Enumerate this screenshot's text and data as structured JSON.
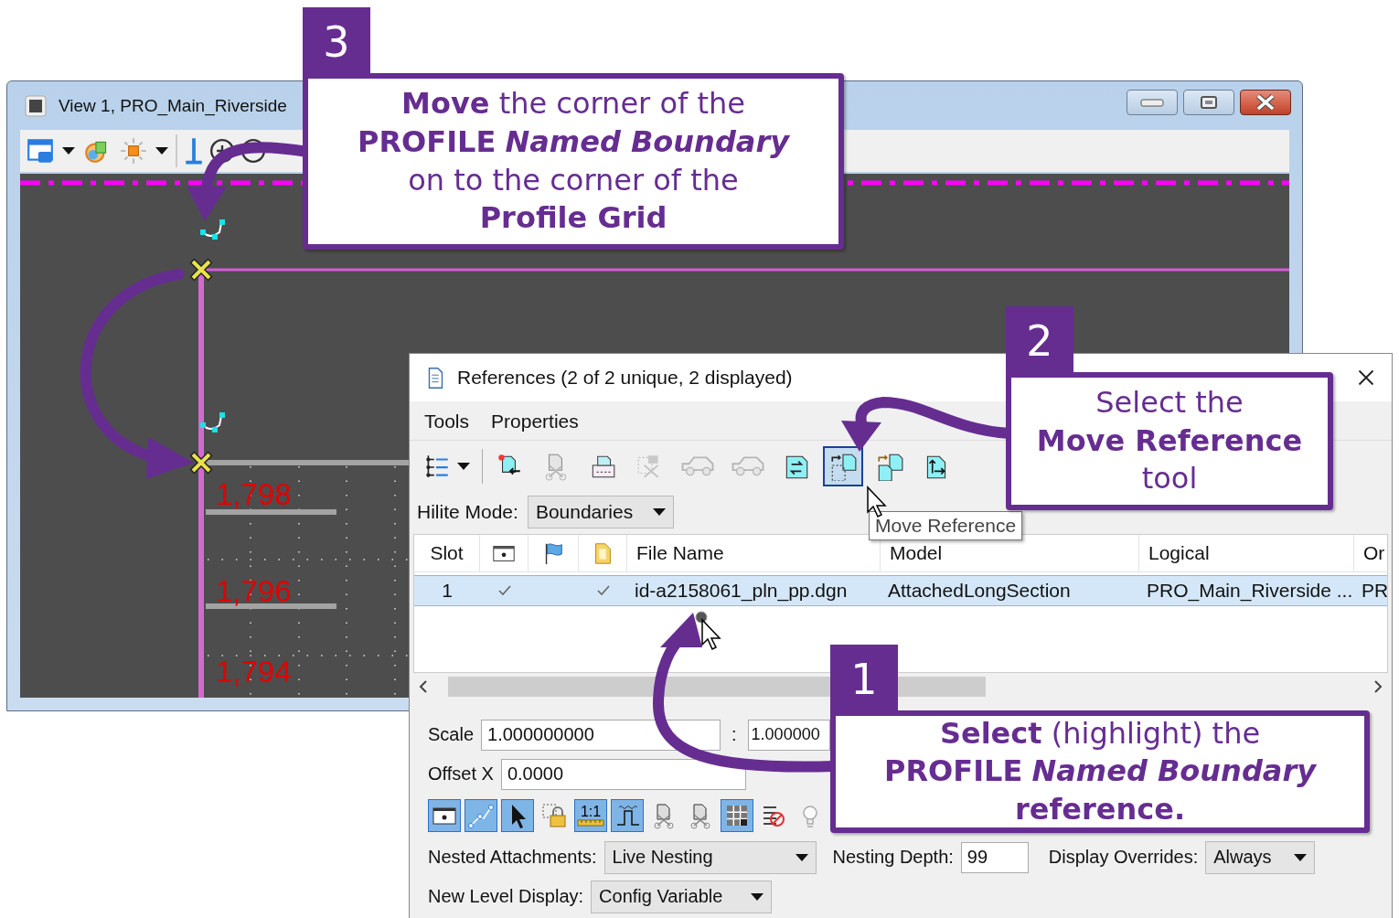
{
  "view_window": {
    "title": "View 1, PRO_Main_Riverside",
    "elevation_labels": [
      "1,798",
      "1,796",
      "1,794"
    ]
  },
  "references_dialog": {
    "title": "References (2 of 2 unique, 2 displayed)",
    "menu": [
      "Tools",
      "Properties"
    ],
    "toolbar": [
      {
        "kind": "tree",
        "selected": false,
        "disabled": false
      },
      {
        "kind": "attach",
        "selected": false,
        "disabled": false
      },
      {
        "kind": "detach",
        "selected": false,
        "disabled": true
      },
      {
        "kind": "print",
        "selected": false,
        "disabled": false
      },
      {
        "kind": "clip",
        "selected": false,
        "disabled": true
      },
      {
        "kind": "car",
        "selected": false,
        "disabled": true
      },
      {
        "kind": "car-back",
        "selected": false,
        "disabled": true
      },
      {
        "kind": "exchange",
        "selected": false,
        "disabled": false
      },
      {
        "kind": "move",
        "selected": true,
        "disabled": false
      },
      {
        "kind": "copy",
        "selected": false,
        "disabled": false
      },
      {
        "kind": "scale",
        "selected": false,
        "disabled": false
      }
    ],
    "tooltip": "Move Reference",
    "hilite_mode": {
      "label": "Hilite Mode:",
      "value": "Boundaries"
    },
    "table": {
      "columns": [
        {
          "kind": "text",
          "label": "Slot"
        },
        {
          "kind": "display-icon"
        },
        {
          "kind": "flag-icon"
        },
        {
          "kind": "document-icon"
        },
        {
          "kind": "text",
          "label": "File Name"
        },
        {
          "kind": "text",
          "label": "Model"
        },
        {
          "kind": "text",
          "label": "Logical"
        },
        {
          "kind": "text",
          "label": "Or"
        }
      ],
      "rows": [
        {
          "selected": true,
          "slot": "1",
          "checks": [
            true,
            false,
            true
          ],
          "file_name": "id-a2158061_pln_pp.dgn",
          "model": "AttachedLongSection",
          "logical": "PRO_Main_Riverside ...",
          "column_8": "PR"
        }
      ]
    },
    "scale": {
      "label": "Scale",
      "value": "1.000000000",
      "separator": ":",
      "value_2": "1.000000"
    },
    "offset": {
      "label": "Offset X",
      "value": "0.0000"
    },
    "toggles": [
      {
        "kind": "display",
        "on": true
      },
      {
        "kind": "path",
        "on": true
      },
      {
        "kind": "pointer",
        "on": true
      },
      {
        "kind": "lock",
        "on": false
      },
      {
        "kind": "ratio",
        "on": true,
        "label": "1:1"
      },
      {
        "kind": "wave",
        "on": true
      },
      {
        "kind": "clip-a",
        "on": false
      },
      {
        "kind": "clip-b",
        "on": false
      },
      {
        "kind": "grid",
        "on": true
      },
      {
        "kind": "layers",
        "on": false
      },
      {
        "kind": "bulb",
        "on": false
      }
    ],
    "nested_attachments": {
      "label": "Nested Attachments:",
      "value": "Live Nesting"
    },
    "nesting_depth": {
      "label": "Nesting Depth:",
      "value": "99"
    },
    "display_overrides": {
      "label": "Display Overrides:",
      "value": "Always"
    },
    "new_level_display": {
      "label": "New Level Display:",
      "value": "Config Variable"
    }
  },
  "callouts": [
    {
      "number": "3",
      "text": "**Move** the corner of the\n**PROFILE** *Named Boundary*\non to the corner of the\n**Profile Grid**"
    },
    {
      "number": "2",
      "text": "Select the\n**Move Reference**\ntool"
    },
    {
      "number": "1",
      "text": "**Select** (highlight) the\n**PROFILE** *Named Boundary*\n**reference.**"
    }
  ]
}
